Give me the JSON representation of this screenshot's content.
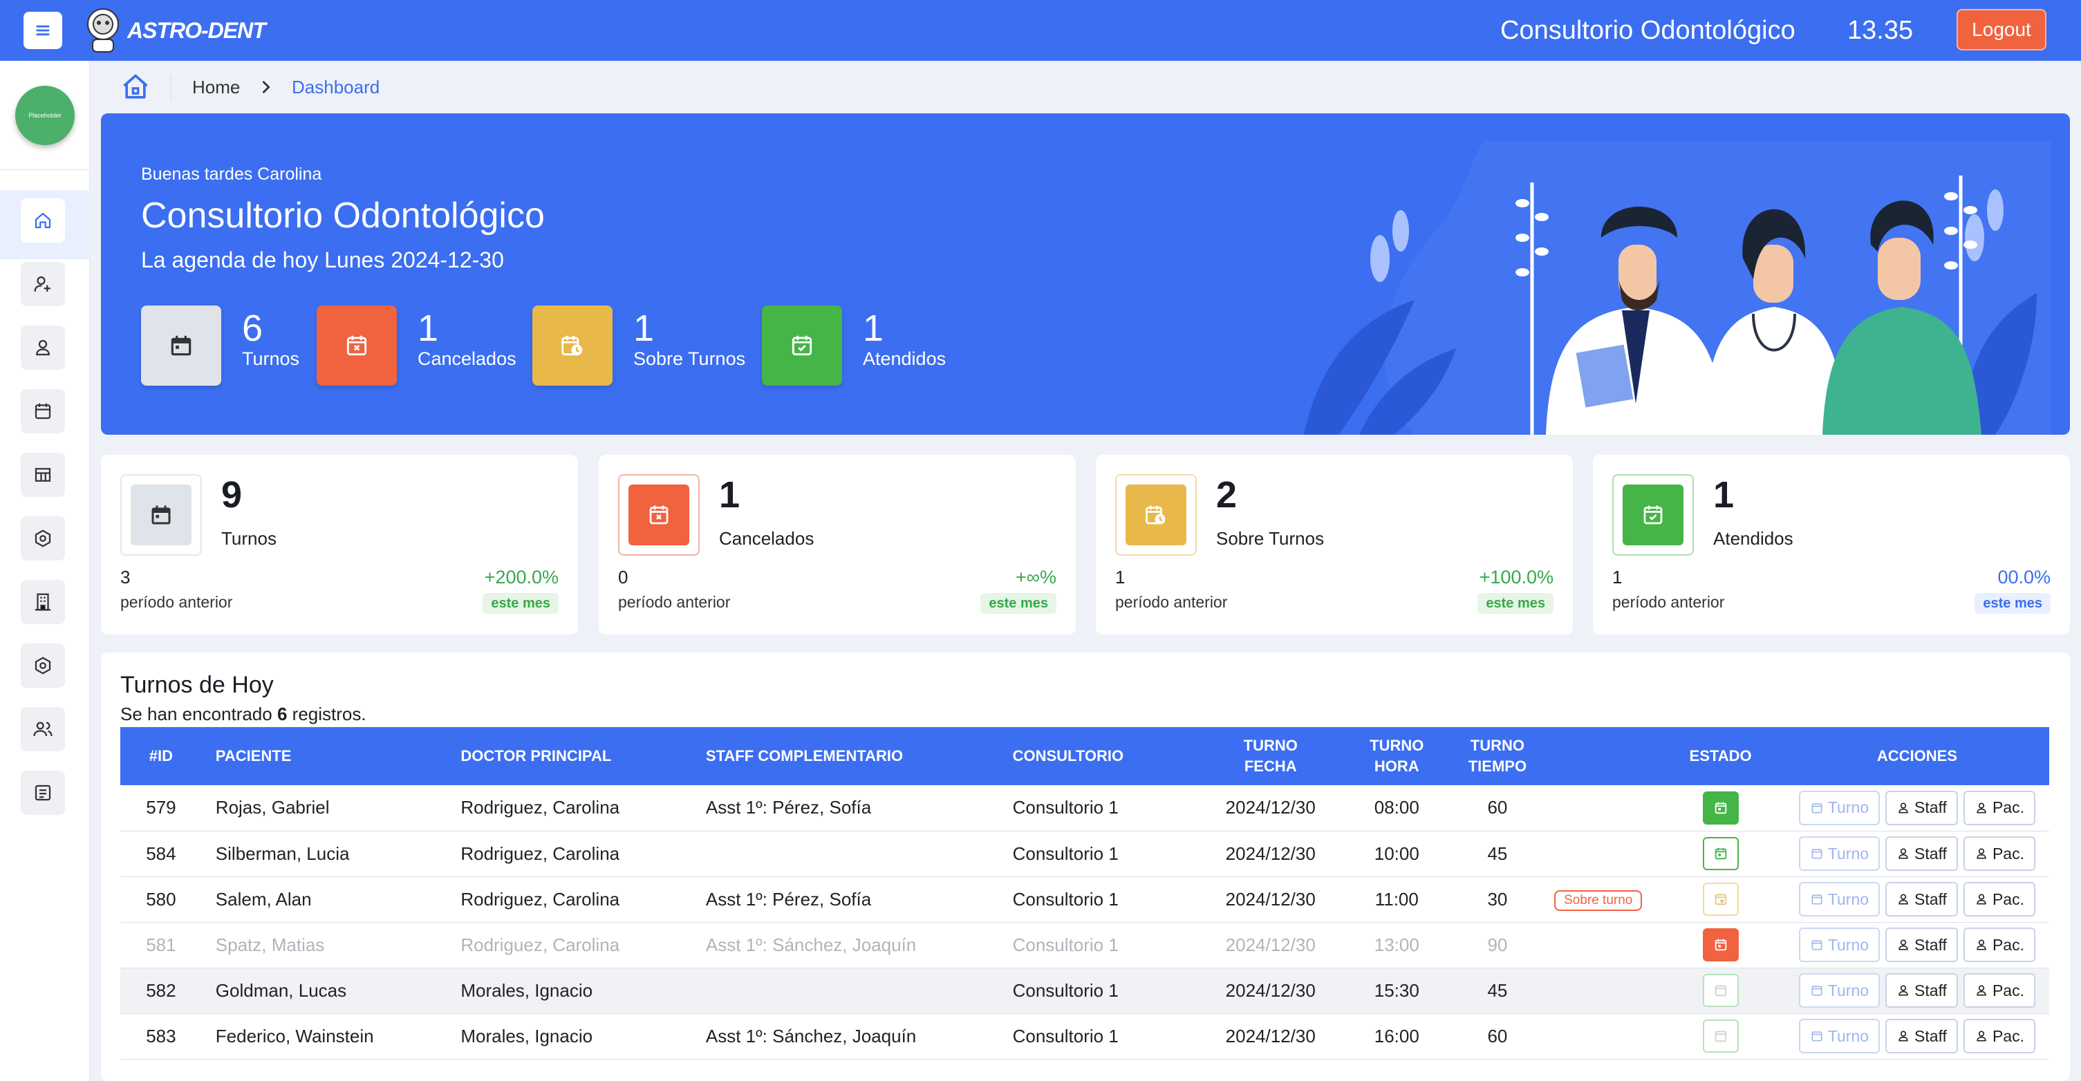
{
  "app": {
    "logo_text": "ASTRO-DENT",
    "title": "Consultorio Odontológico",
    "time": "13.35",
    "logout_label": "Logout",
    "avatar_text": "Placeholder"
  },
  "breadcrumb": {
    "home": "Home",
    "current": "Dashboard"
  },
  "hero": {
    "greeting": "Buenas tardes Carolina",
    "title": "Consultorio Odontológico",
    "subtitle": "La agenda de hoy Lunes 2024-12-30",
    "stats": [
      {
        "value": "6",
        "label": "Turnos"
      },
      {
        "value": "1",
        "label": "Cancelados"
      },
      {
        "value": "1",
        "label": "Sobre Turnos"
      },
      {
        "value": "1",
        "label": "Atendidos"
      }
    ]
  },
  "cards": [
    {
      "value": "9",
      "label": "Turnos",
      "previous": "3",
      "previous_label": "período anterior",
      "change": "+200.0%",
      "period": "este mes"
    },
    {
      "value": "1",
      "label": "Cancelados",
      "previous": "0",
      "previous_label": "período anterior",
      "change": "+∞%",
      "period": "este mes"
    },
    {
      "value": "2",
      "label": "Sobre Turnos",
      "previous": "1",
      "previous_label": "período anterior",
      "change": "+100.0%",
      "period": "este mes"
    },
    {
      "value": "1",
      "label": "Atendidos",
      "previous": "1",
      "previous_label": "período anterior",
      "change": "00.0%",
      "period": "este mes"
    }
  ],
  "table": {
    "title": "Turnos de Hoy",
    "found_prefix": "Se han encontrado",
    "found_count": "6",
    "found_suffix": "registros.",
    "headers": {
      "id": "#ID",
      "paciente": "PACIENTE",
      "doctor": "DOCTOR PRINCIPAL",
      "staff": "STAFF COMPLEMENTARIO",
      "consultorio": "CONSULTORIO",
      "fecha_1": "TURNO",
      "fecha_2": "FECHA",
      "hora_1": "TURNO",
      "hora_2": "HORA",
      "tiempo_1": "TURNO",
      "tiempo_2": "TIEMPO",
      "estado": "ESTADO",
      "acciones": "ACCIONES"
    },
    "action_labels": {
      "turno": "Turno",
      "staff": "Staff",
      "pac": "Pac."
    },
    "rows": [
      {
        "id": "579",
        "paciente": "Rojas, Gabriel",
        "doctor": "Rodriguez, Carolina",
        "staff": "Asst 1º: Pérez, Sofía",
        "consultorio": "Consultorio 1",
        "fecha": "2024/12/30",
        "hora": "08:00",
        "tiempo": "60",
        "badge": "",
        "estado": "atendido-filled"
      },
      {
        "id": "584",
        "paciente": "Silberman, Lucia",
        "doctor": "Rodriguez, Carolina",
        "staff": "",
        "consultorio": "Consultorio 1",
        "fecha": "2024/12/30",
        "hora": "10:00",
        "tiempo": "45",
        "badge": "",
        "estado": "atendido-outline"
      },
      {
        "id": "580",
        "paciente": "Salem, Alan",
        "doctor": "Rodriguez, Carolina",
        "staff": "Asst 1º: Pérez, Sofía",
        "consultorio": "Consultorio 1",
        "fecha": "2024/12/30",
        "hora": "11:00",
        "tiempo": "30",
        "badge": "Sobre turno",
        "estado": "sobre-outline"
      },
      {
        "id": "581",
        "paciente": "Spatz, Matias",
        "doctor": "Rodriguez, Carolina",
        "staff": "Asst 1º: Sánchez, Joaquín",
        "consultorio": "Consultorio 1",
        "fecha": "2024/12/30",
        "hora": "13:00",
        "tiempo": "90",
        "badge": "",
        "estado": "cancelado-filled"
      },
      {
        "id": "582",
        "paciente": "Goldman, Lucas",
        "doctor": "Morales, Ignacio",
        "staff": "",
        "consultorio": "Consultorio 1",
        "fecha": "2024/12/30",
        "hora": "15:30",
        "tiempo": "45",
        "badge": "",
        "estado": "pendiente-outline"
      },
      {
        "id": "583",
        "paciente": "Federico, Wainstein",
        "doctor": "Morales, Ignacio",
        "staff": "Asst 1º: Sánchez, Joaquín",
        "consultorio": "Consultorio 1",
        "fecha": "2024/12/30",
        "hora": "16:00",
        "tiempo": "60",
        "badge": "",
        "estado": "pendiente-outline"
      }
    ]
  },
  "colors": {
    "primary": "#3b6ef0",
    "danger": "#f1623f",
    "warning": "#e8b94a",
    "success": "#45b547",
    "neutral": "#dfe3ea"
  }
}
